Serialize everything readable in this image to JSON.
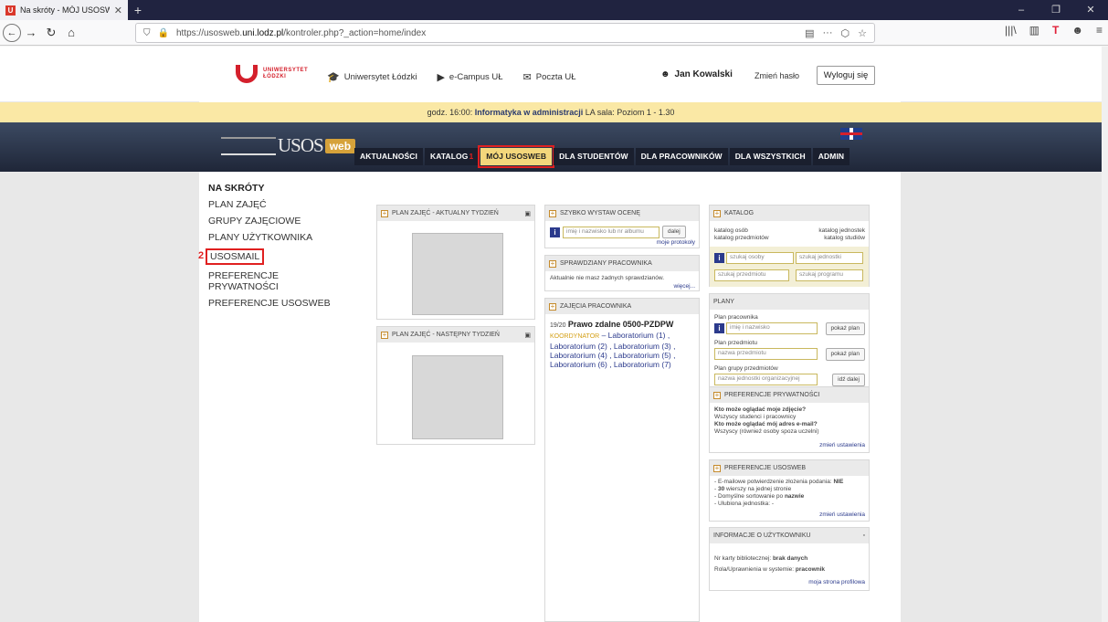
{
  "browser": {
    "tab_title": "Na skróty - MÓJ USOSWEB - U:",
    "tab_favicon": "U",
    "url_prefix": "https://usosweb.",
    "url_domain": "uni.lodz.pl",
    "url_suffix": "/kontroler.php?_action=home/index",
    "new_tab": "+",
    "window_minimize": "–",
    "window_restore": "❐",
    "window_close": "✕",
    "reader_icon": "▤",
    "more_icon": "···",
    "pocket_icon": "⬡",
    "star_icon": "☆",
    "library_icon": "|||\\",
    "sidebar_icon": "▥",
    "ext_t": "T",
    "account_icon": "☻",
    "menu_icon": "≡"
  },
  "top": {
    "ul_line1": "UNIWERSYTET",
    "ul_line2": "ŁÓDZKI",
    "links": [
      {
        "icon": "🎓",
        "label": "Uniwersytet Łódzki"
      },
      {
        "icon": "▶",
        "label": "e-Campus UŁ"
      },
      {
        "icon": "✉",
        "label": "Poczta UŁ"
      }
    ],
    "user": "Jan Kowalski",
    "change_pw": "Zmień hasło",
    "logout": "Wyloguj się"
  },
  "info": {
    "prefix": "godz. 16:00:",
    "course": "Informatyka w administracji",
    "suffix": "LA sala: Poziom 1 - 1.30"
  },
  "logo": {
    "usos": "USOS",
    "web": "web"
  },
  "menu": {
    "items": [
      "AKTUALNOŚCI",
      "KATALOG",
      "MÓJ USOSWEB",
      "DLA STUDENTÓW",
      "DLA PRACOWNIKÓW",
      "DLA WSZYSTKICH",
      "ADMIN"
    ],
    "annot1": "1"
  },
  "sidenav": {
    "title": "NA SKRÓTY",
    "items": [
      "PLAN ZAJĘĆ",
      "GRUPY ZAJĘCIOWE",
      "PLANY UŻYTKOWNIKA",
      "USOSMAIL",
      "PREFERENCJE PRYWATNOŚCI",
      "PREFERENCJE USOSWEB"
    ],
    "annot2": "2"
  },
  "plan1": {
    "title": "PLAN ZAJĘĆ - AKTUALNY TYDZIEŃ"
  },
  "plan2": {
    "title": "PLAN ZAJĘĆ - NASTĘPNY TYDZIEŃ"
  },
  "quickgrade": {
    "title": "SZYBKO WYSTAW OCENĘ",
    "placeholder": "imię i nazwisko lub nr albumu",
    "btn": "dalej",
    "link": "moje protokoły"
  },
  "tests": {
    "title": "SPRAWDZIANY PRACOWNIKA",
    "text": "Aktualnie nie masz żadnych sprawdzianów.",
    "more": "więcej..."
  },
  "classes": {
    "title": "ZAJĘCIA PRACOWNIKA",
    "year": "19/20",
    "name": "Prawo zdalne",
    "code": "0500-PZDPW",
    "role": "KOORDYNATOR",
    "labs": "– Laboratorium (1) , Laboratorium (2) , Laboratorium (3) , Laboratorium (4) , Laboratorium (5) , Laboratorium (6) , Laboratorium (7)"
  },
  "katalog": {
    "title": "KATALOG",
    "l1": "katalog osób",
    "r1": "katalog jednostek",
    "l2": "katalog przedmiotów",
    "r2": "katalog studiów",
    "in1": "szukaj osoby",
    "in2": "szukaj jednostki",
    "in3": "szukaj przedmiotu",
    "in4": "szukaj programu"
  },
  "plany": {
    "title": "PLANY",
    "l1": "Plan pracownika",
    "p1": "imię i nazwisko",
    "b1": "pokaż plan",
    "l2": "Plan przedmiotu",
    "p2": "nazwa przedmiotu",
    "b2": "pokaż plan",
    "l3": "Plan grupy przedmiotów",
    "p3": "nazwa jednostki organizacyjnej",
    "b3": "idź dalej"
  },
  "priv": {
    "title": "PREFERENCJE PRYWATNOŚCI",
    "q1": "Kto może oglądać moje zdjęcie?",
    "a1": "Wszyscy studenci i pracownicy",
    "q2": "Kto może oglądać mój adres e-mail?",
    "a2": "Wszyscy (również osoby spoza uczelni)",
    "link": "zmień ustawienia"
  },
  "prefweb": {
    "title": "PREFERENCJE USOSWEB",
    "i1a": "- E-mailowe potwierdzenie złożenia podania: ",
    "i1b": "NIE",
    "i2a": "- ",
    "i2b": "30",
    "i2c": " wierszy na jednej stronie",
    "i3a": "- Domyślne sortowanie po ",
    "i3b": "nazwie",
    "i4": "- Ulubiona jednostka: -",
    "link": "zmień ustawienia"
  },
  "userinfo": {
    "title": "INFORMACJE O UŻYTKOWNIKU",
    "l1": "Nr karty bibliotecznej: ",
    "v1": "brak danych",
    "l2": "Rola/Uprawnienia w systemie: ",
    "v2": "pracownik",
    "link": "moja strona profilowa"
  }
}
